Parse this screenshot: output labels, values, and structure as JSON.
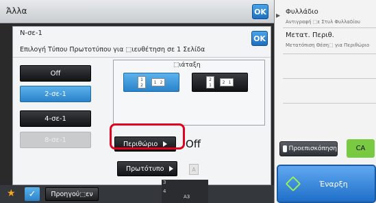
{
  "top_bar": {
    "title": "Άλλα",
    "ok_label": "OK"
  },
  "dialog": {
    "title": "N-σε-1",
    "subtitle": "Επιλογή Τύπου Πρωτοτύπου για ⬚ιευθέτηση σε 1 Σελίδα",
    "ok_label": "OK",
    "options": [
      {
        "label": "Off",
        "state": "normal"
      },
      {
        "label": "2-σε-1",
        "state": "selected"
      },
      {
        "label": "4-σε-1",
        "state": "normal"
      },
      {
        "label": "8-σε-1",
        "state": "disabled"
      }
    ],
    "layout": {
      "title": "⬚ιάταξη",
      "option_a": {
        "pages": [
          "1",
          "2"
        ],
        "selected": true
      },
      "option_b": {
        "pages": [
          "2",
          "1"
        ],
        "selected": false
      }
    },
    "border_button": "Περιθώριο",
    "border_value": "Off",
    "original_button": "Πρωτότυπο",
    "a_icon": "A"
  },
  "right_panel": {
    "item1": {
      "title": "Φυλλάδιο",
      "sub": "Αντιγραφή ⬚ε Στυλ Φυλλαδίου"
    },
    "item2": {
      "title": "Μετατ. Περιθ.",
      "sub": "Μετατόπιση Θέση⬚ για Περιθώριο"
    },
    "preview_label": "Προεπισκόπηση",
    "ca_label": "CA",
    "start_label": "Έναρξη"
  },
  "bottom_bar": {
    "prev_label": "Προηγού⬚εν",
    "tray_label": "A3",
    "tray_num_left": "3",
    "tray_num_right": "4"
  },
  "colors": {
    "accent_blue": "#2a83c9",
    "highlight_red": "#e0001b",
    "ca_green": "#7ac943",
    "star_orange": "#f6a623"
  }
}
